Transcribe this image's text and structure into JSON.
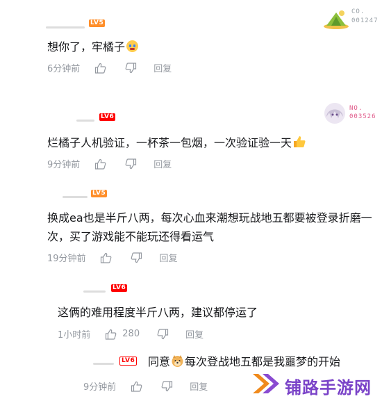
{
  "comments": [
    {
      "level": "LV5",
      "text": "想你了，牢橘子",
      "time": "6分钟前",
      "reply": "回复",
      "fan_badge": {
        "no": "CO.",
        "num": "001247"
      }
    },
    {
      "level": "LV6",
      "text": "烂橘子人机验证，一杯茶一包烟，一次验证验一天",
      "time": "9分钟前",
      "reply": "回复",
      "fan_badge": {
        "no": "NO.",
        "num": "003526"
      }
    },
    {
      "level": "LV5",
      "text_line1": "换成ea也是半斤八两，每次心血来潮想玩战地五都要被登录折磨一",
      "text_line2": "次，买了游戏能不能玩还得看运气",
      "time": "19分钟前",
      "reply": "回复"
    },
    {
      "level": "LV6",
      "text": "这俩的难用程度半斤八两，建议都停运了",
      "time": "1小时前",
      "likes": "280",
      "reply": "回复"
    },
    {
      "level": "LV6",
      "text_a": "同意",
      "text_b": "每次登战地五都是我噩梦的开始",
      "time": "9分钟前",
      "reply": "回复"
    }
  ],
  "watermark": {
    "text": "铺路手游网"
  }
}
